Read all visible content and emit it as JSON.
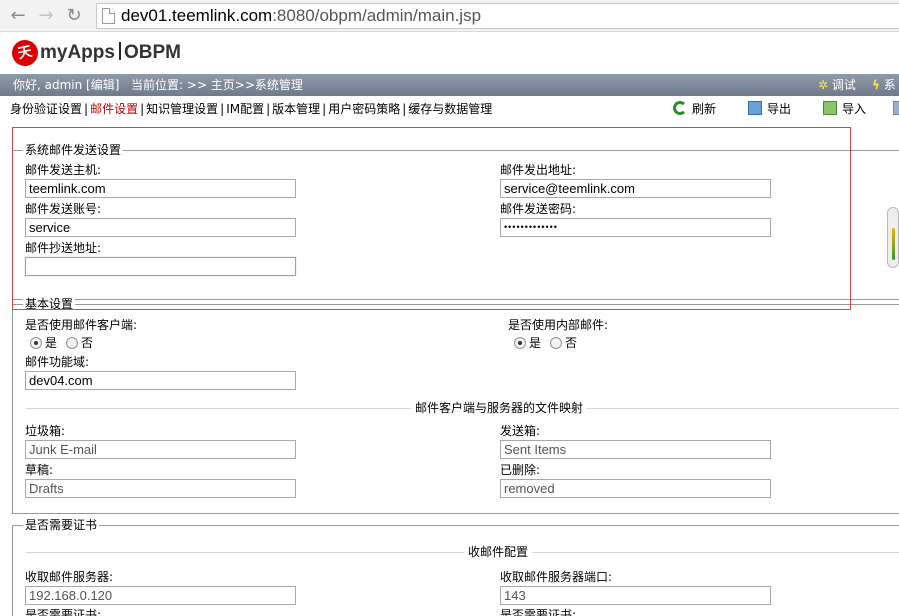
{
  "browser": {
    "url_host": "dev01.teemlink.com",
    "url_rest": ":8080/obpm/admin/main.jsp"
  },
  "app": {
    "logo_mark": "天",
    "logo_text": "myApps",
    "product": "OBPM"
  },
  "status": {
    "greeting": "你好, admin [编辑]",
    "location": "当前位置: >> 主页>>系统管理",
    "debug": "调试",
    "system_cut": "系"
  },
  "tabs": [
    {
      "label": "身份验证设置",
      "active": false
    },
    {
      "label": "邮件设置",
      "active": true
    },
    {
      "label": "知识管理设置",
      "active": false
    },
    {
      "label": "IM配置",
      "active": false
    },
    {
      "label": "版本管理",
      "active": false
    },
    {
      "label": "用户密码策略",
      "active": false
    },
    {
      "label": "缓存与数据管理",
      "active": false
    }
  ],
  "toolbar": {
    "refresh": "刷新",
    "export": "导出",
    "import": "导入"
  },
  "send": {
    "legend": "系统邮件发送设置",
    "host_label": "邮件发送主机:",
    "host_value": "teemlink.com",
    "from_label": "邮件发出地址:",
    "from_value": "service@teemlink.com",
    "account_label": "邮件发送账号:",
    "account_value": "service",
    "password_label": "邮件发送密码:",
    "password_value": "•••••••••••••",
    "cc_label": "邮件抄送地址:",
    "cc_value": ""
  },
  "basic": {
    "legend": "基本设置",
    "client_label": "是否使用邮件客户端:",
    "internal_label": "是否使用内部邮件:",
    "yes": "是",
    "no": "否",
    "client_selected": "是",
    "internal_selected": "是",
    "domain_label": "邮件功能域:",
    "domain_value": "dev04.com",
    "mapping_title": "邮件客户端与服务器的文件映射",
    "trash_label": "垃圾箱:",
    "trash_value": "Junk E-mail",
    "sent_label": "发送箱:",
    "sent_value": "Sent Items",
    "drafts_label": "草稿:",
    "drafts_value": "Drafts",
    "deleted_label": "已删除:",
    "deleted_value": "removed"
  },
  "cert": {
    "legend": "是否需要证书",
    "receive_title": "收邮件配置",
    "server_label": "收取邮件服务器:",
    "server_value": "192.168.0.120",
    "port_label": "收取邮件服务器端口:",
    "port_value": "143",
    "need_cert_left": "是否需要证书:",
    "need_cert_right": "是否需要证书:"
  }
}
